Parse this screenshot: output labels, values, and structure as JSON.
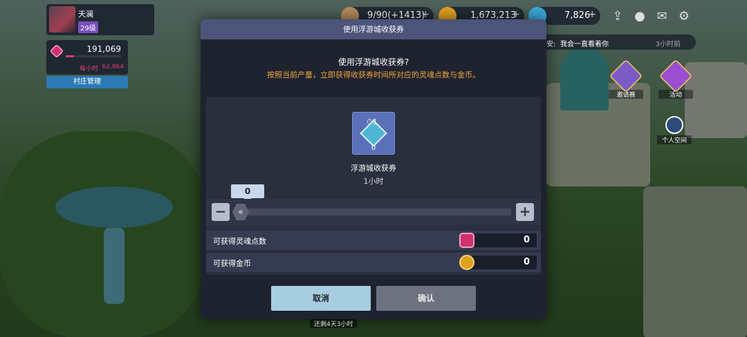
{
  "player": {
    "name": "天澜",
    "level": "29级"
  },
  "soul_panel": {
    "value": "191,069",
    "rate_label": "每小时",
    "rate_value": "62,864",
    "village_button": "村庄管理"
  },
  "hud": {
    "stamina": "9/90(+1413)",
    "gold": "1,673,213",
    "gems": "7,826"
  },
  "chat": {
    "speaker_suffix": "安:",
    "message": "我会一直看着你",
    "time": "3小时前"
  },
  "side_buttons": [
    {
      "label": "邀请赛"
    },
    {
      "label": "活动"
    },
    {
      "label": "个人空间"
    }
  ],
  "bottom_timer": "还剩4天3小时",
  "modal": {
    "title": "使用浮游城收获券",
    "question": "使用浮游城收获券?",
    "description": "按照当前产量，立即获得收获券时间所对应的灵魂点数与金币。",
    "item": {
      "badge": "1",
      "quantity": "0",
      "name": "浮游城收获券",
      "duration": "1小时"
    },
    "slider": {
      "value": "0",
      "minus": "−",
      "plus": "+"
    },
    "rewards": [
      {
        "label": "可获得灵魂点数",
        "value": "0",
        "icon": "soul-gem-icon",
        "color": "#d0306e"
      },
      {
        "label": "可获得金币",
        "value": "0",
        "icon": "gold-coin-icon",
        "color": "#e0a020"
      }
    ],
    "cancel_label": "取消",
    "confirm_label": "确认"
  }
}
